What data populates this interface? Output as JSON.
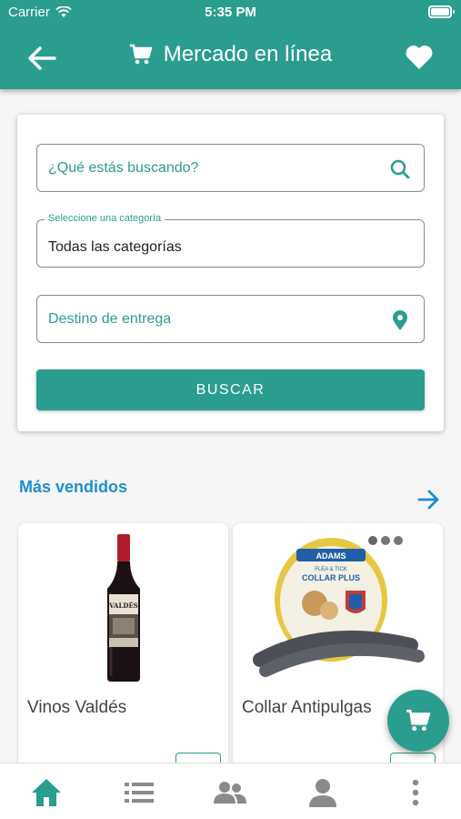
{
  "status_bar": {
    "carrier": "Carrier",
    "time": "5:35 PM"
  },
  "header": {
    "title": "Mercado en línea",
    "back_icon": "arrow-left-icon",
    "favorite_icon": "heart-icon",
    "cart_icon": "cart-icon"
  },
  "search": {
    "query_placeholder": "¿Qué estás buscando?",
    "category_label": "Seleccione una categoría",
    "category_value": "Todas las categorías",
    "destination_placeholder": "Destino de entrega",
    "button_label": "BUSCAR"
  },
  "best_sellers": {
    "title": "Más vendidos",
    "products": [
      {
        "name": "Vinos Valdés"
      },
      {
        "name": "Collar Antipulgas"
      }
    ]
  },
  "image_text": {
    "brand": "ADAMS",
    "collar_line1": "FLEA & TICK",
    "collar_line2": "COLLAR PLUS",
    "wine_label": "VALDÉS"
  },
  "bottom_nav": [
    "home-icon",
    "list-icon",
    "people-icon",
    "person-icon",
    "more-icon"
  ],
  "colors": {
    "primary": "#2a9d8f",
    "accent_blue": "#1c8fd0"
  }
}
